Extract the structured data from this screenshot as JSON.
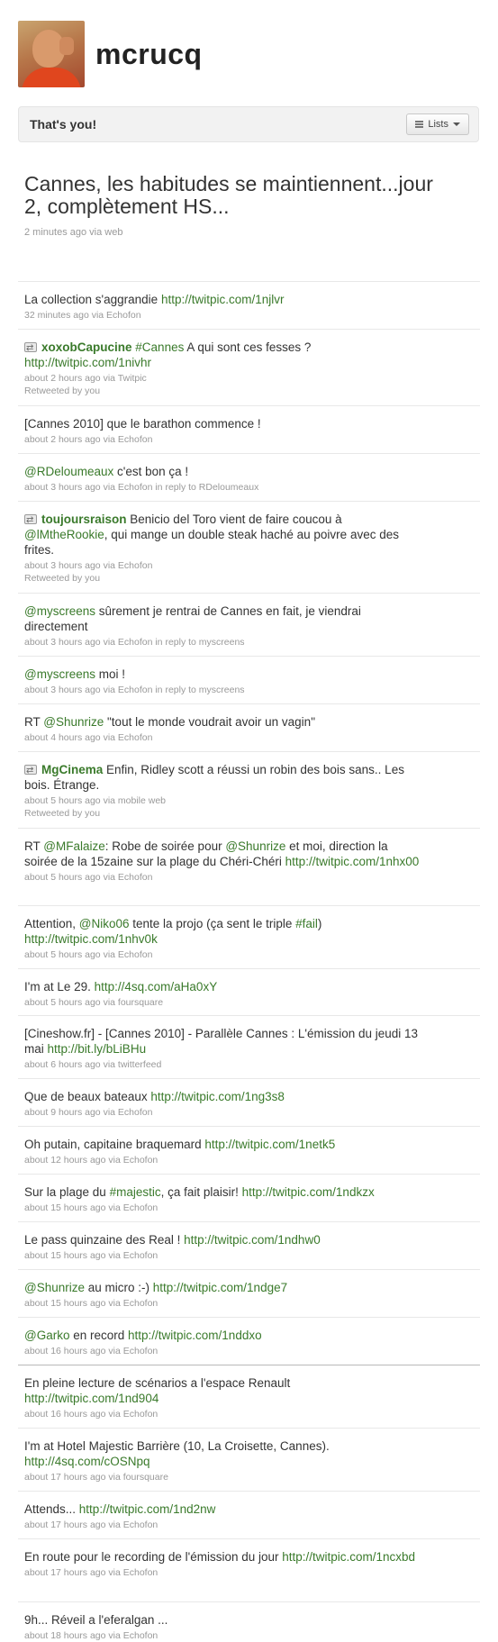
{
  "profile": {
    "screen_name": "mcrucq"
  },
  "you_bar": {
    "label": "That's you!",
    "lists_button": "Lists"
  },
  "featured_tweet": {
    "text": "Cannes, les habitudes se maintiennent...jour 2, complètement HS...",
    "meta": "2 minutes ago via web"
  },
  "timeline": [
    {
      "text": "La collection s'aggrandie ",
      "link": "http://twitpic.com/1njlvr",
      "meta": "32 minutes ago via Echofon"
    },
    {
      "author": "xoxobCapucine",
      "hashtag": "#Cannes",
      "text": " A qui sont ces fesses ? ",
      "link": "http://twitpic.com/1nivhr",
      "meta": "about 2 hours ago via Twitpic",
      "retweeted": "Retweeted by you"
    },
    {
      "text": "[Cannes 2010] que le barathon commence !",
      "meta": "about 2 hours ago via Echofon"
    },
    {
      "mention": "@RDeloumeaux",
      "text": " c'est bon ça !",
      "meta": "about 3 hours ago via Echofon in reply to RDeloumeaux"
    },
    {
      "author": "toujoursraison",
      "text": "Benicio del Toro vient de faire coucou à ",
      "mention": "@lMtheRookie",
      "text2": ", qui mange un double steak haché au poivre avec des frites.",
      "meta": "about 3 hours ago via Echofon",
      "retweeted": "Retweeted by you"
    },
    {
      "mention": "@myscreens",
      "text": " sûrement je rentrai de Cannes en fait, je viendrai directement",
      "meta": "about 3 hours ago via Echofon in reply to myscreens"
    },
    {
      "mention": "@myscreens",
      "text": " moi !",
      "meta": "about 3 hours ago via Echofon in reply to myscreens"
    },
    {
      "text": "RT ",
      "mention": "@Shunrize",
      "text2": " \"tout le monde voudrait avoir un vagin\"",
      "meta": "about 4 hours ago via Echofon"
    },
    {
      "author": "MgCinema",
      "text": "Enfin, Ridley scott a réussi un robin des bois sans.. Les bois. Étrange.",
      "meta": "about 5 hours ago via mobile web",
      "retweeted": "Retweeted by you"
    },
    {
      "text": "RT ",
      "mention": "@MFalaize",
      "text2": ": Robe de soirée pour ",
      "mention2": "@Shunrize",
      "text3": " et moi, direction la soirée de la 15zaine sur la plage du Chéri-Chéri ",
      "link": "http://twitpic.com/1nhx00",
      "meta": "about 5 hours ago via Echofon"
    },
    {
      "text": "Attention, ",
      "mention": "@Niko06",
      "text2": " tente la projo (ça sent le triple ",
      "hashtag": "#fail",
      "text3": ") ",
      "link": "http://twitpic.com/1nhv0k",
      "meta": "about 5 hours ago via Echofon"
    },
    {
      "text": "I'm at Le 29. ",
      "link": "http://4sq.com/aHa0xY",
      "meta": "about 5 hours ago via foursquare"
    },
    {
      "text": "[Cineshow.fr] - [Cannes 2010] - Parallèle Cannes : L'émission du jeudi 13 mai ",
      "link": "http://bit.ly/bLiBHu",
      "meta": "about 6 hours ago via twitterfeed"
    },
    {
      "text": "Que de beaux bateaux ",
      "link": "http://twitpic.com/1ng3s8",
      "meta": "about 9 hours ago via Echofon"
    },
    {
      "text": "Oh putain, capitaine braquemard ",
      "link": "http://twitpic.com/1netk5",
      "meta": "about 12 hours ago via Echofon"
    },
    {
      "text": "Sur la plage du ",
      "hashtag": "#majestic",
      "text2": ", ça fait plaisir! ",
      "link": "http://twitpic.com/1ndkzx",
      "meta": "about 15 hours ago via Echofon"
    },
    {
      "text": "Le pass quinzaine des Real ! ",
      "link": "http://twitpic.com/1ndhw0",
      "meta": "about 15 hours ago via Echofon"
    },
    {
      "mention": "@Shunrize",
      "text": " au micro :-) ",
      "link": "http://twitpic.com/1ndge7",
      "meta": "about 15 hours ago via Echofon"
    },
    {
      "mention": "@Garko",
      "text": " en record ",
      "link": "http://twitpic.com/1nddxo",
      "meta": "about 16 hours ago via Echofon"
    },
    {
      "text": "En pleine lecture de scénarios a l'espace Renault ",
      "link": "http://twitpic.com/1nd904",
      "meta": "about 16 hours ago via Echofon"
    },
    {
      "text": "I'm at Hotel Majestic Barrière (10, La Croisette, Cannes). ",
      "link": "http://4sq.com/cOSNpq",
      "meta": "about 17 hours ago via foursquare"
    },
    {
      "text": "Attends... ",
      "link": "http://twitpic.com/1nd2nw",
      "meta": "about 17 hours ago via Echofon"
    },
    {
      "text": "En route pour le recording de l'émission du jour ",
      "link": "http://twitpic.com/1ncxbd",
      "meta": "about 17 hours ago via Echofon"
    },
    {
      "text": "9h... Réveil a l'eferalgan ...",
      "meta": "about 18 hours ago via Echofon"
    }
  ]
}
